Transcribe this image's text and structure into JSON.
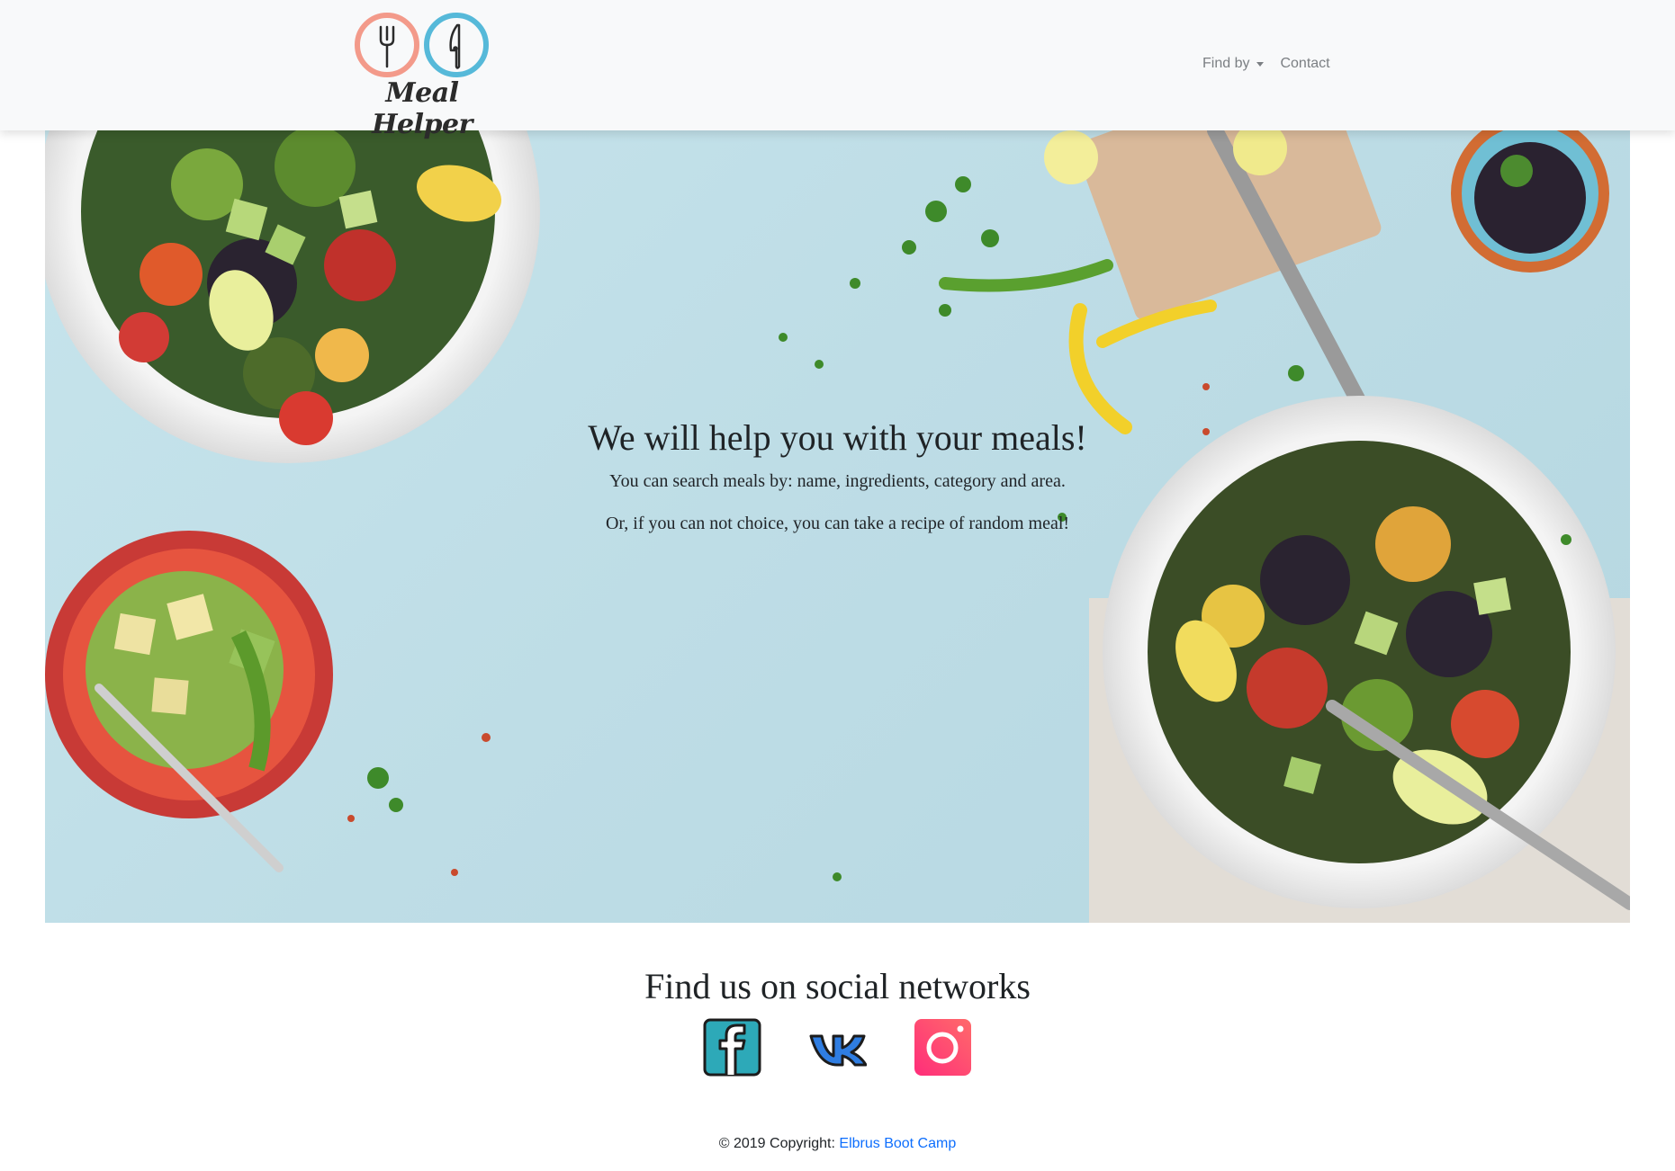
{
  "brand": {
    "logo_text": "Meal Helper",
    "logo_colors": {
      "left_ring": "#f39a8a",
      "right_ring": "#56b9d9",
      "text": "#2b2b2b"
    },
    "icons": [
      "fork-icon",
      "knife-icon"
    ]
  },
  "nav": {
    "find_by_label": "Find by",
    "contact_label": "Contact"
  },
  "hero": {
    "title": "We will help you with your meals!",
    "line1": "You can search meals by: name, ingredients, category and area.",
    "line2": "Or, if you can not choice, you can take a recipe of random meal!"
  },
  "social": {
    "title": "Find us on social networks",
    "icons": [
      "facebook-icon",
      "vk-icon",
      "instagram-icon"
    ]
  },
  "footer": {
    "copyright": "© 2019 Copyright: ",
    "link_text": "Elbrus Boot Camp"
  },
  "colors": {
    "navbar_bg": "#f8f9fa",
    "nav_text": "#7b7f83",
    "hero_bg": "#bfdee7",
    "link": "#0d6efd"
  }
}
